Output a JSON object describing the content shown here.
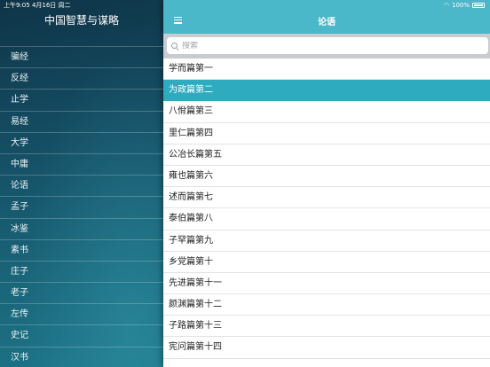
{
  "status_bar": {
    "time_date": "上午9:05   4月16日 周二",
    "battery_pct": "100%",
    "wifi_icon": "wifi-icon",
    "battery_icon": "battery-icon"
  },
  "sidebar": {
    "title": "中国智慧与谋略",
    "items": [
      {
        "label": "骗经"
      },
      {
        "label": "反经"
      },
      {
        "label": "止学"
      },
      {
        "label": "易经"
      },
      {
        "label": "大学"
      },
      {
        "label": "中庸"
      },
      {
        "label": "论语"
      },
      {
        "label": "孟子"
      },
      {
        "label": "冰鉴"
      },
      {
        "label": "素书"
      },
      {
        "label": "庄子"
      },
      {
        "label": "老子"
      },
      {
        "label": "左传"
      },
      {
        "label": "史记"
      },
      {
        "label": "汉书"
      }
    ]
  },
  "main": {
    "title": "论语",
    "menu_icon": "hamburger-menu-icon",
    "search": {
      "placeholder": "搜索",
      "value": "",
      "icon": "search-icon"
    },
    "selected_index": 1,
    "colors": {
      "nav_bar": "#4ab8c8",
      "selected_row": "#2fabc0"
    },
    "chapters": [
      {
        "label": "学而篇第一"
      },
      {
        "label": "为政篇第二"
      },
      {
        "label": "八佾篇第三"
      },
      {
        "label": "里仁篇第四"
      },
      {
        "label": "公冶长篇第五"
      },
      {
        "label": "雍也篇第六"
      },
      {
        "label": "述而篇第七"
      },
      {
        "label": "泰伯篇第八"
      },
      {
        "label": "子罕篇第九"
      },
      {
        "label": "乡党篇第十"
      },
      {
        "label": "先进篇第十一"
      },
      {
        "label": "颜渊篇第十二"
      },
      {
        "label": "子路篇第十三"
      },
      {
        "label": "宪问篇第十四"
      }
    ]
  }
}
